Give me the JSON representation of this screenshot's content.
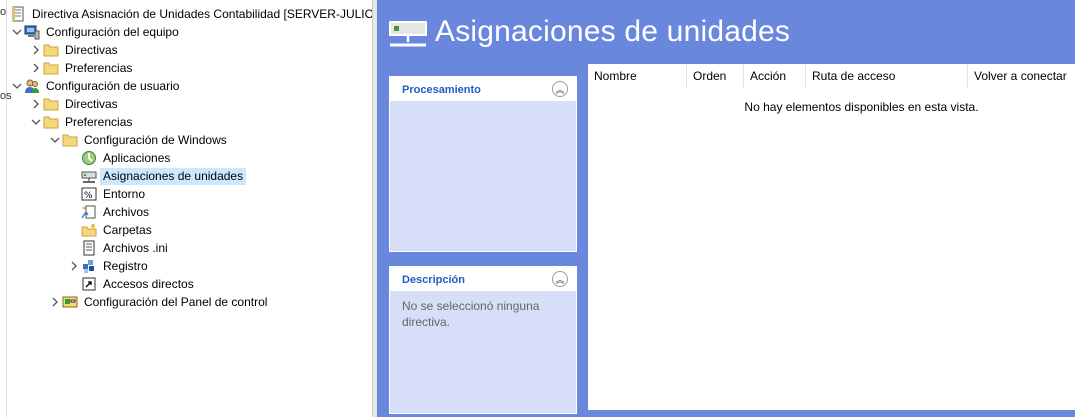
{
  "tree": {
    "cutoff_text": "o",
    "cutoff_text2": "os",
    "root": "Directiva Asisnación de Unidades Contabilidad [SERVER-JULIO.N",
    "computer_config": "Configuración del equipo",
    "cc_policies": "Directivas",
    "cc_preferences": "Preferencias",
    "user_config": "Configuración de usuario",
    "uc_policies": "Directivas",
    "uc_preferences": "Preferencias",
    "windows_settings": "Configuración de Windows",
    "applications": "Aplicaciones",
    "drive_maps": "Asignaciones de unidades",
    "environment": "Entorno",
    "files": "Archivos",
    "folders": "Carpetas",
    "ini_files": "Archivos .ini",
    "registry": "Registro",
    "shortcuts": "Accesos directos",
    "control_panel": "Configuración del Panel de control"
  },
  "header": {
    "title": "Asignaciones de unidades"
  },
  "panels": {
    "processing": {
      "title": "Procesamiento"
    },
    "description": {
      "title": "Descripción",
      "text": "No se seleccionó ninguna directiva."
    }
  },
  "list": {
    "columns": [
      "Nombre",
      "Orden",
      "Acción",
      "Ruta de acceso",
      "Volver a conectar"
    ],
    "empty_text": "No hay elementos disponibles en esta vista."
  },
  "colors": {
    "header_bg": "#6a87de",
    "panel_bg": "#d6dff7",
    "panel_title": "#215dc6",
    "selection": "#cce8ff"
  }
}
